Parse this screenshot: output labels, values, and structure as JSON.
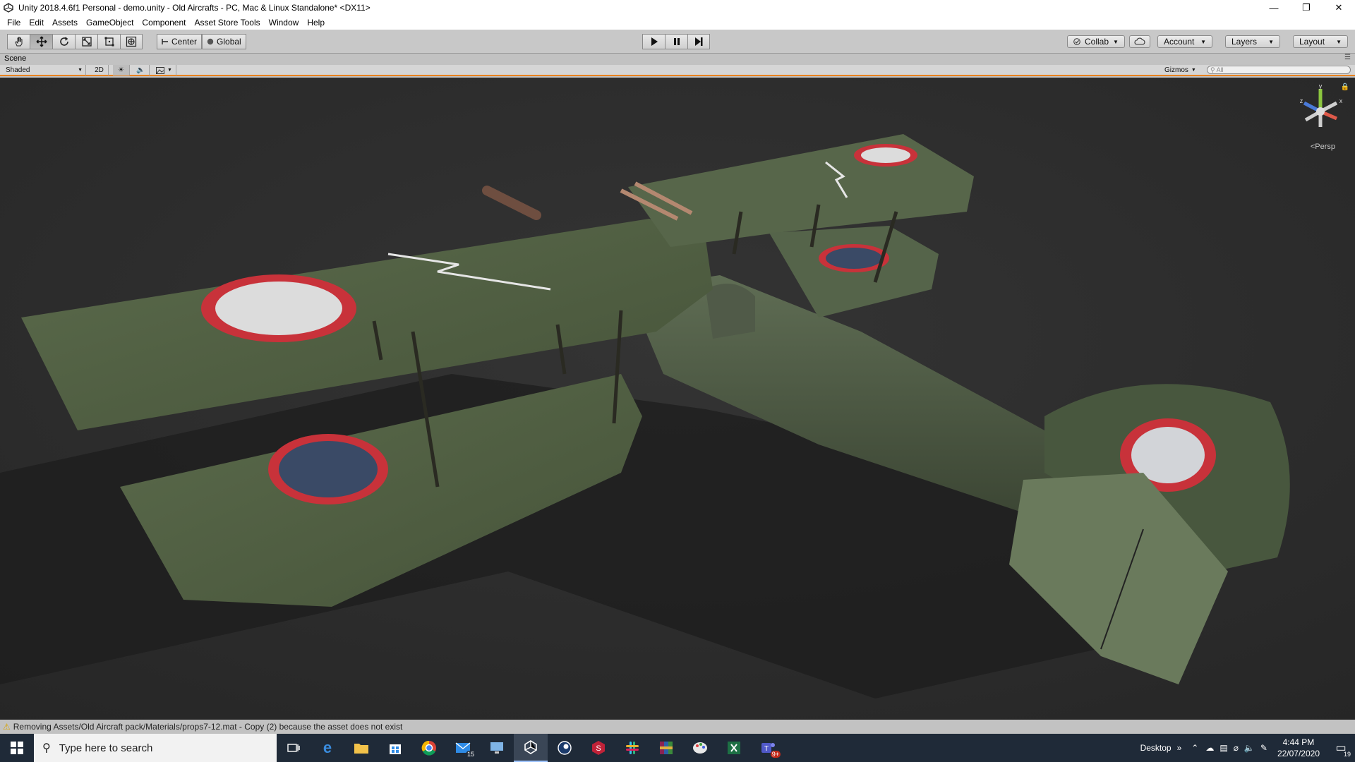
{
  "window": {
    "title": "Unity 2018.4.6f1 Personal - demo.unity - Old Aircrafts - PC, Mac & Linux Standalone* <DX11>"
  },
  "menu": [
    "File",
    "Edit",
    "Assets",
    "GameObject",
    "Component",
    "Asset Store Tools",
    "Window",
    "Help"
  ],
  "toolbar": {
    "pivot_label": "Center",
    "space_label": "Global",
    "collab_label": "Collab",
    "account_label": "Account",
    "layers_label": "Layers",
    "layout_label": "Layout"
  },
  "scene": {
    "tab_label": "Scene",
    "shading_mode": "Shaded",
    "toggle_2d": "2D",
    "gizmos_label": "Gizmos",
    "search_placeholder": "All",
    "projection_label": "Persp",
    "axes": {
      "x": "x",
      "y": "y",
      "z": "z"
    }
  },
  "status": {
    "message": "Removing Assets/Old Aircraft pack/Materials/props7-12.mat - Copy (2) because the asset does not exist"
  },
  "taskbar": {
    "search_placeholder": "Type here to search",
    "mail_badge": "15",
    "teams_badge": "9+",
    "desktop_label": "Desktop",
    "time": "4:44 PM",
    "date": "22/07/2020",
    "notification_count": "19"
  },
  "colors": {
    "accent": "#e8821e",
    "viewport_bg": "#2c2c2c",
    "taskbar_bg": "#1f2a38"
  }
}
